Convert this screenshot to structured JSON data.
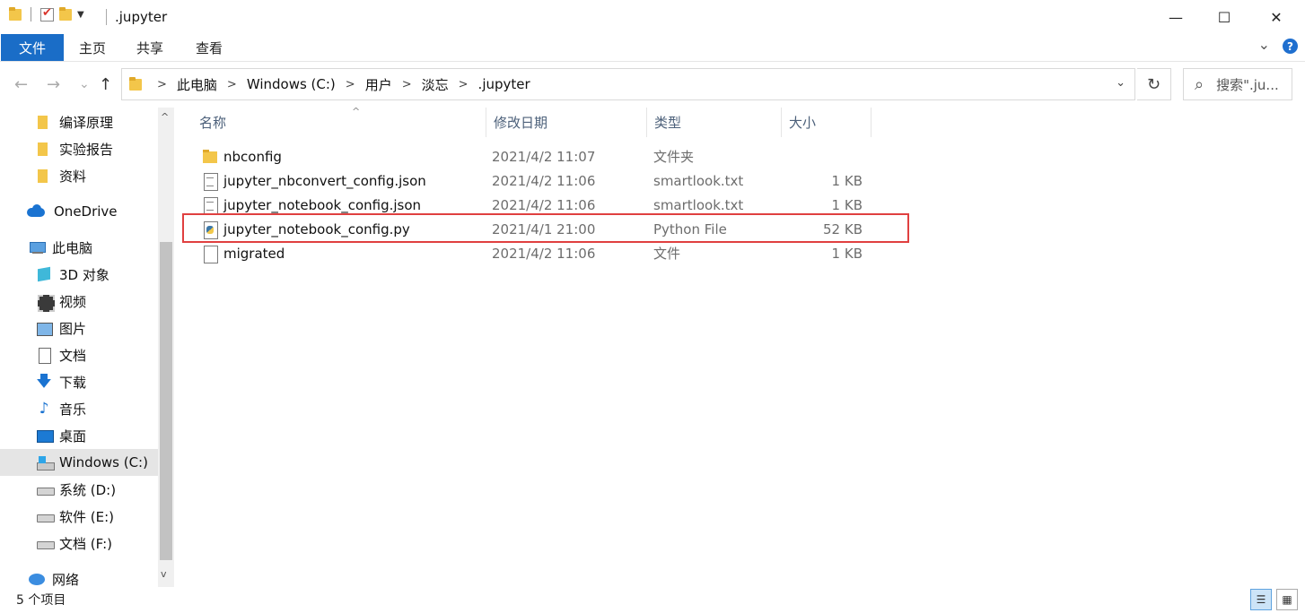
{
  "window": {
    "title": ".jupyter",
    "minimize_glyph": "—",
    "maximize_glyph": "☐",
    "close_glyph": "✕"
  },
  "ribbon": {
    "tabs": [
      "文件",
      "主页",
      "共享",
      "查看"
    ],
    "expand_glyph": "⌄",
    "help_glyph": "?"
  },
  "nav_buttons": {
    "back": "←",
    "forward": "→",
    "recent": "⌄",
    "up": "↑"
  },
  "address": {
    "breadcrumbs": [
      "此电脑",
      "Windows (C:)",
      "用户",
      "淡忘",
      ".jupyter"
    ],
    "separator": ">",
    "dropdown_glyph": "⌄",
    "refresh_glyph": "↻"
  },
  "search": {
    "icon": "⌕",
    "placeholder": "搜索\".ju..."
  },
  "nav_pane": {
    "items": [
      {
        "label": "编译原理",
        "icon": "folder-icon"
      },
      {
        "label": "实验报告",
        "icon": "folder-icon"
      },
      {
        "label": "资料",
        "icon": "folder-icon"
      },
      {
        "label": "OneDrive",
        "icon": "onedrive-icon"
      },
      {
        "label": "此电脑",
        "icon": "this-pc-icon"
      },
      {
        "label": "3D 对象",
        "icon": "3d-objects-icon"
      },
      {
        "label": "视频",
        "icon": "videos-icon"
      },
      {
        "label": "图片",
        "icon": "pictures-icon"
      },
      {
        "label": "文档",
        "icon": "documents-icon"
      },
      {
        "label": "下载",
        "icon": "downloads-icon"
      },
      {
        "label": "音乐",
        "icon": "music-icon"
      },
      {
        "label": "桌面",
        "icon": "desktop-icon"
      },
      {
        "label": "Windows (C:)",
        "icon": "windows-drive-icon"
      },
      {
        "label": "系统 (D:)",
        "icon": "drive-icon"
      },
      {
        "label": "软件 (E:)",
        "icon": "drive-icon"
      },
      {
        "label": "文档 (F:)",
        "icon": "drive-icon"
      },
      {
        "label": "网络",
        "icon": "network-icon"
      }
    ],
    "selected": "Windows (C:)",
    "scroll_up": "^",
    "scroll_down": "v"
  },
  "columns": {
    "name": "名称",
    "date": "修改日期",
    "type": "类型",
    "size": "大小",
    "sort_glyph": "^"
  },
  "files": [
    {
      "name": "nbconfig",
      "date": "2021/4/2 11:07",
      "type": "文件夹",
      "size": "",
      "icon": "folder-icon"
    },
    {
      "name": "jupyter_nbconvert_config.json",
      "date": "2021/4/2 11:06",
      "type": "smartlook.txt",
      "size": "1 KB",
      "icon": "json-file-icon"
    },
    {
      "name": "jupyter_notebook_config.json",
      "date": "2021/4/2 11:06",
      "type": "smartlook.txt",
      "size": "1 KB",
      "icon": "json-file-icon"
    },
    {
      "name": "jupyter_notebook_config.py",
      "date": "2021/4/1 21:00",
      "type": "Python File",
      "size": "52 KB",
      "icon": "python-file-icon"
    },
    {
      "name": "migrated",
      "date": "2021/4/2 11:06",
      "type": "文件",
      "size": "1 KB",
      "icon": "blank-file-icon"
    }
  ],
  "highlighted_file": "jupyter_notebook_config.py",
  "highlight_color": "#e04040",
  "status": {
    "item_count": "5 个项目",
    "details_view_glyph": "☰",
    "tiles_view_glyph": "▦"
  },
  "accent_color": "#1a6dc7"
}
